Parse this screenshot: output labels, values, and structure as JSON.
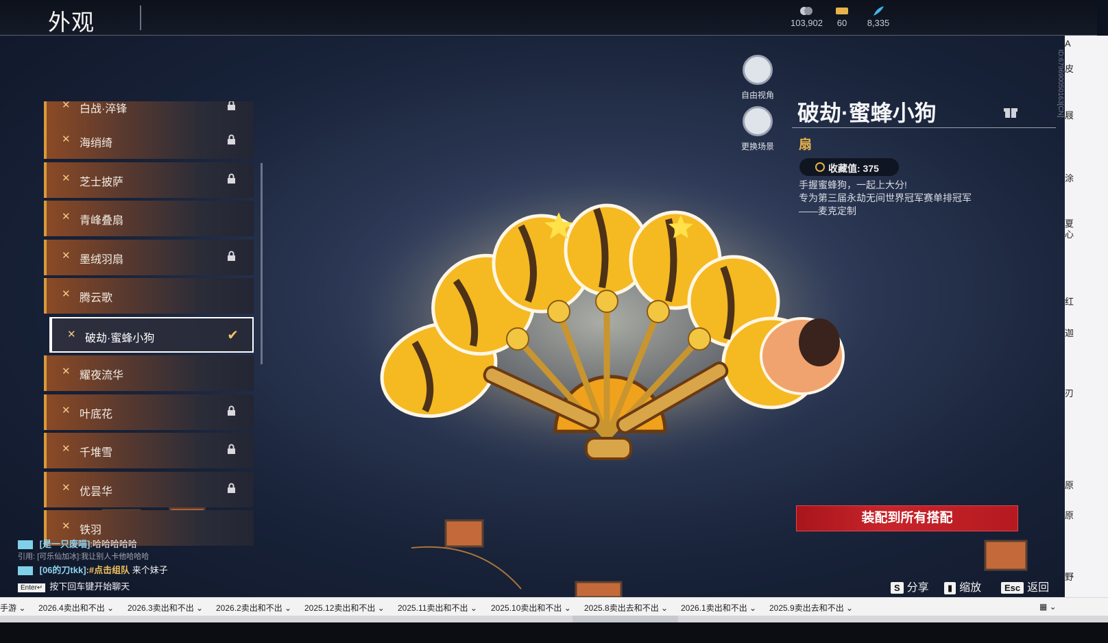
{
  "header": {
    "title": "外观",
    "currencies": [
      {
        "icon": "coin-icon",
        "value": "103,902"
      },
      {
        "icon": "ticket-icon",
        "value": "60"
      },
      {
        "icon": "feather-icon",
        "value": "8,335"
      }
    ]
  },
  "list": {
    "items": [
      {
        "label": "白战·淬锋",
        "locked": true
      },
      {
        "label": "海绡绮",
        "locked": true
      },
      {
        "label": "芝士披萨",
        "locked": true
      },
      {
        "label": "青峰叠扇",
        "locked": false
      },
      {
        "label": "墨绒羽扇",
        "locked": true
      },
      {
        "label": "腾云歌",
        "locked": false
      },
      {
        "label": "破劫·蜜蜂小狗",
        "locked": false,
        "selected": true
      },
      {
        "label": "耀夜流华",
        "locked": false
      },
      {
        "label": "叶底花",
        "locked": true
      },
      {
        "label": "千堆雪",
        "locked": true
      },
      {
        "label": "优昙华",
        "locked": true
      },
      {
        "label": "铁羽",
        "locked": false
      }
    ]
  },
  "view_buttons": {
    "free_view": "自由视角",
    "change_scene": "更换场景"
  },
  "detail": {
    "name": "破劫·蜜蜂小狗",
    "type": "扇",
    "collect_value": "收藏值: 375",
    "description": [
      "手握蜜蜂狗，一起上大分!",
      "专为第三届永劫无间世界冠军赛单排冠军",
      "——麦克定制"
    ],
    "equip_all": "装配到所有搭配"
  },
  "chat": {
    "line1_name": "[是一只废喵]",
    "line1_msg": ":哈哈哈哈哈",
    "quote": "引用: [可乐仙加冰]:我让别人卡他哈哈哈",
    "line2_name": "[06的刀tkk]",
    "line2_cmd": ":#点击组队",
    "line2_msg": " 来个妹子",
    "enter_key": "Enter↵",
    "enter_hint": "按下回车键开始聊天"
  },
  "hints": {
    "share_key": "S",
    "share": "分享",
    "zoom": "缩放",
    "back_key": "Esc",
    "back": "返回"
  },
  "side": {
    "id": "ID:67969005016​3[CN]",
    "chars": [
      "A",
      "皮",
      "屐",
      "涂",
      "夏",
      "心",
      "红",
      "迦",
      "刃",
      "原",
      "原",
      "野"
    ]
  },
  "bookmarks": [
    "手游",
    "2026.4卖出和不出",
    "2026.3卖出和不出",
    "2026.2卖出和不出",
    "2025.12卖出和不出",
    "2025.11卖出和不出",
    "2025.10卖出和不出",
    "2025.8卖出去和不出",
    "2026.1卖出和不出",
    "2025.9卖出去和不出"
  ],
  "colors": {
    "accent_gold": "#e6b24a",
    "equip_red": "#c8242b",
    "chat_name": "#8fd4ef"
  }
}
